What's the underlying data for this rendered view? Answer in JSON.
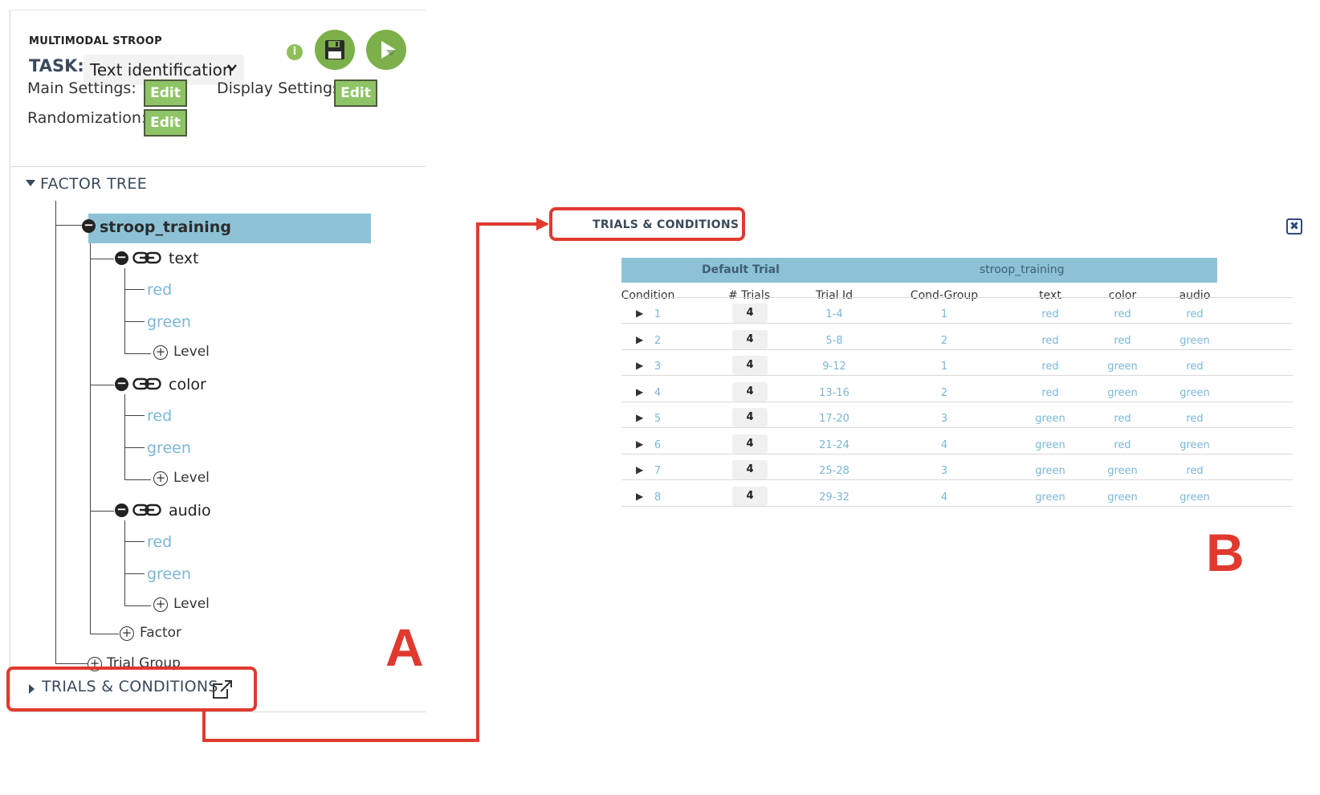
{
  "app": {
    "name": "MULTIMODAL STROOP",
    "task_label": "TASK:",
    "task_value": "Text identification"
  },
  "settings": {
    "main_label": "Main Settings:",
    "display_label": "Display Settings:",
    "randomization_label": "Randomization:",
    "edit_label": "Edit"
  },
  "icons": {
    "info": "info-icon",
    "save": "floppy-disk-icon",
    "play": "play-icon",
    "link": "link-icon",
    "external": "external-link-icon"
  },
  "factor_tree": {
    "title": "FACTOR TREE",
    "trial_group": "stroop_training",
    "factors": [
      {
        "name": "text",
        "levels": [
          "red",
          "green"
        ]
      },
      {
        "name": "color",
        "levels": [
          "red",
          "green"
        ]
      },
      {
        "name": "audio",
        "levels": [
          "red",
          "green"
        ]
      }
    ],
    "add_level": "Level",
    "add_factor": "Factor",
    "add_trial_group": "Trial Group"
  },
  "trials_section": {
    "title": "TRIALS & CONDITIONS"
  },
  "annotations": {
    "a": "A",
    "b": "B"
  },
  "trials_table": {
    "title": "TRIALS & CONDITIONS",
    "close": "✖",
    "group_headers": [
      "Default Trial",
      "stroop_training"
    ],
    "columns": [
      "Condition",
      "# Trials",
      "Trial Id",
      "Cond-Group",
      "text",
      "color",
      "audio"
    ],
    "rows": [
      {
        "condition": "1",
        "trials": "4",
        "trial_id": "1-4",
        "cond_group": "1",
        "text": "red",
        "color": "red",
        "audio": "red"
      },
      {
        "condition": "2",
        "trials": "4",
        "trial_id": "5-8",
        "cond_group": "2",
        "text": "red",
        "color": "red",
        "audio": "green"
      },
      {
        "condition": "3",
        "trials": "4",
        "trial_id": "9-12",
        "cond_group": "1",
        "text": "red",
        "color": "green",
        "audio": "red"
      },
      {
        "condition": "4",
        "trials": "4",
        "trial_id": "13-16",
        "cond_group": "2",
        "text": "red",
        "color": "green",
        "audio": "green"
      },
      {
        "condition": "5",
        "trials": "4",
        "trial_id": "17-20",
        "cond_group": "3",
        "text": "green",
        "color": "red",
        "audio": "red"
      },
      {
        "condition": "6",
        "trials": "4",
        "trial_id": "21-24",
        "cond_group": "4",
        "text": "green",
        "color": "red",
        "audio": "green"
      },
      {
        "condition": "7",
        "trials": "4",
        "trial_id": "25-28",
        "cond_group": "3",
        "text": "green",
        "color": "green",
        "audio": "red"
      },
      {
        "condition": "8",
        "trials": "4",
        "trial_id": "29-32",
        "cond_group": "4",
        "text": "green",
        "color": "green",
        "audio": "green"
      }
    ]
  },
  "colors": {
    "accent_green": "#7cb04a",
    "header_blue": "#8dc2d6",
    "level_blue": "#7ab6d6",
    "annotation_red": "#e03a2f"
  }
}
